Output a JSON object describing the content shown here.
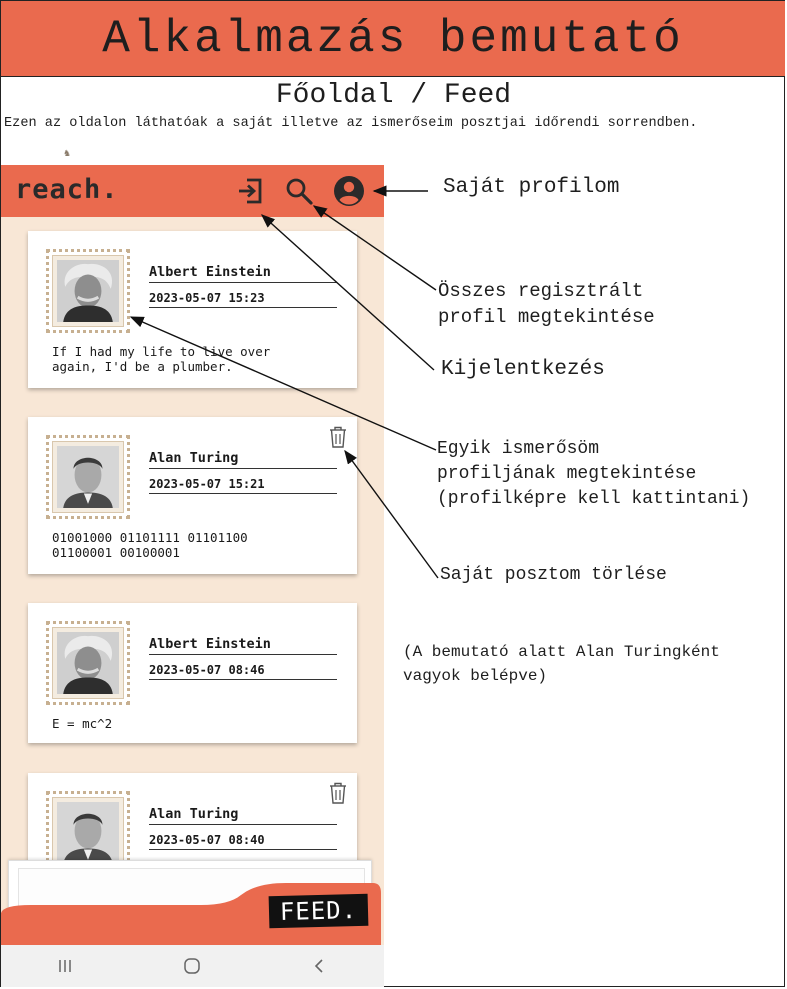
{
  "header": {
    "title": "Alkalmazás bemutató"
  },
  "page": {
    "title": "Főoldal / Feed",
    "description": "Ezen az oldalon láthatóak a saját illetve az ismerőseim posztjai időrendi sorrendben."
  },
  "app": {
    "logo": "reach.",
    "icons": {
      "logout": "logout-icon",
      "search": "search-icon",
      "profile": "account-circle-icon"
    },
    "posts": [
      {
        "author": "Albert Einstein",
        "date": "2023-05-07 15:23",
        "content": "If I had my life to live over\nagain, I'd be a plumber.",
        "own": false
      },
      {
        "author": "Alan Turing",
        "date": "2023-05-07 15:21",
        "content": "01001000 01101111 01101100\n01100001 00100001",
        "own": true
      },
      {
        "author": "Albert Einstein",
        "date": "2023-05-07 08:46",
        "content": "E = mc^2",
        "own": false
      },
      {
        "author": "Alan Turing",
        "date": "2023-05-07 08:40",
        "content": "",
        "own": true
      }
    ],
    "bottom_tab": "FEED.",
    "nav": {
      "recent": "recent-apps-icon",
      "home": "home-icon",
      "back": "back-icon"
    }
  },
  "annotations": {
    "profile": "Saját profilom",
    "all_profiles": "Összes regisztrált\nprofil megtekintése",
    "logout": "Kijelentkezés",
    "friend_profile": "Egyik ismerősöm\nprofiljának megtekintése\n(profilképre kell kattintani)",
    "delete_post": "Saját posztom törlése",
    "note": "(A bemutató alatt Alan Turingként\nvagyok belépve)"
  },
  "colors": {
    "banner": "#ea6a4e",
    "feed_bg": "#f8e7d6",
    "stamp_border": "#c7b091"
  }
}
